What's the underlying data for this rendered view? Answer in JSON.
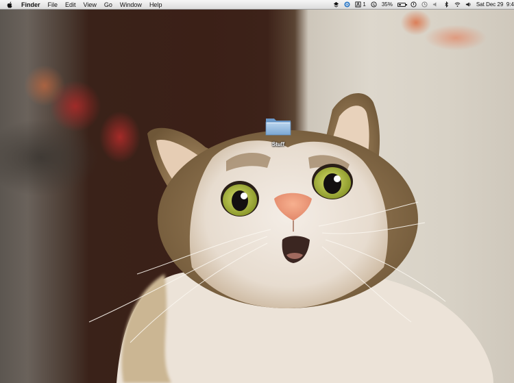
{
  "menubar": {
    "apple_icon": "apple-icon",
    "app_name": "Finder",
    "menus": [
      "File",
      "Edit",
      "View",
      "Go",
      "Window",
      "Help"
    ],
    "status": {
      "notification_count": "1",
      "battery_percent": "35%",
      "datetime": "Sat Dec 29  9:4"
    }
  },
  "desktop": {
    "folder": {
      "label": "Stuff",
      "icon": "folder-icon"
    }
  },
  "colors": {
    "menubar_bg": "#e8e8e8",
    "folder_blue": "#8fb6dc"
  }
}
